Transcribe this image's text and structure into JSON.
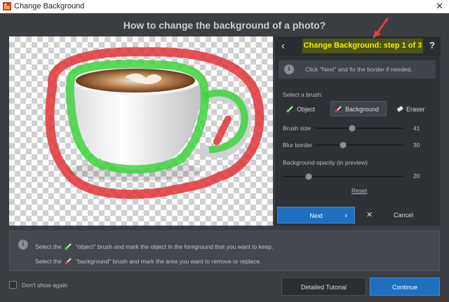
{
  "window": {
    "title": "Change Background",
    "close_glyph": "✕"
  },
  "heading": "How to change the background of a photo?",
  "panel": {
    "back_glyph": "‹",
    "step_label": "Change Background: step 1 of 3",
    "help_glyph": "?",
    "hint_icon": "i",
    "hint": "Click \"Next\" and fix the border if needed.",
    "select_brush_label": "Select a brush:",
    "brushes": [
      {
        "label": "Object",
        "icon": "object-brush-icon",
        "active": false
      },
      {
        "label": "Background",
        "icon": "background-brush-icon",
        "active": true
      },
      {
        "label": "Eraser",
        "icon": "eraser-icon",
        "active": false
      }
    ],
    "sliders": {
      "brush_size": {
        "label": "Brush size",
        "value": "41",
        "level": 0.41
      },
      "blur_border": {
        "label": "Blur border",
        "value": "30",
        "level": 0.3
      },
      "bg_opacity": {
        "label": "Background opacity (in preview)",
        "value": "20",
        "level": 0.2
      }
    },
    "reset_label": "Reset",
    "next_label": "Next",
    "next_arrow": "›",
    "cancel_label": "Cancel",
    "cancel_glyph": "✕"
  },
  "instructions": {
    "info_icon": "i",
    "line1_pre": "Select the",
    "line1_post": "\"object\" brush and mark the object in the foreground that you want to keep.",
    "line2_pre": "Select the",
    "line2_post": "\"background\" brush and mark the area you want to remove or replace."
  },
  "footer": {
    "dont_show": "Don't show again",
    "dont_show_checked": false,
    "tutorial_label": "Detailed Tutorial",
    "continue_label": "Continue"
  },
  "colors": {
    "accent_blue": "#1f6fc1",
    "step_highlight": "#f0f000",
    "object_stroke": "#3ed43e",
    "background_stroke": "#e0353a",
    "annotation_arrow": "#e04040"
  }
}
